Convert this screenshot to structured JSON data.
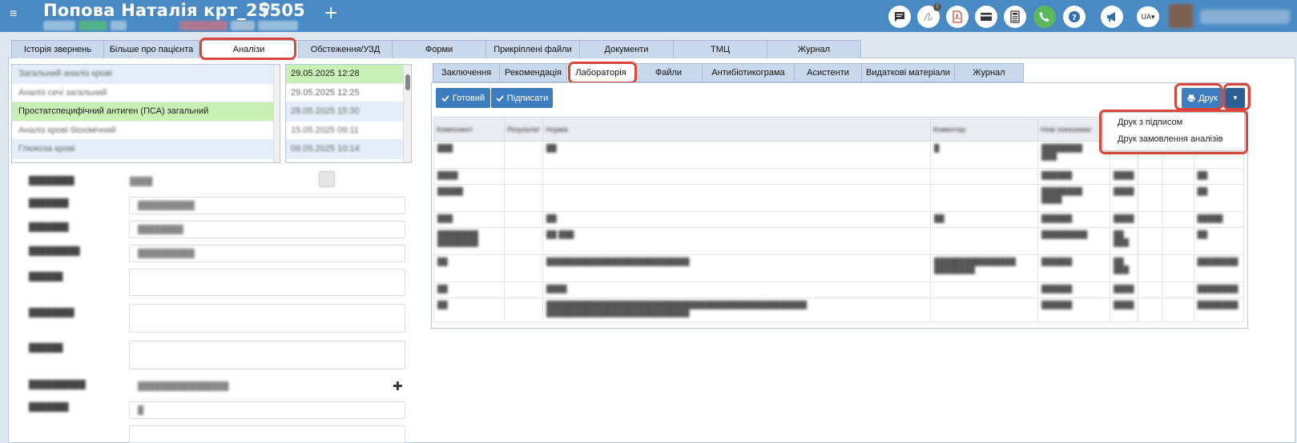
{
  "header": {
    "patient_name": "Попова Наталія крт_25505",
    "gender_symbol": "♀",
    "add_symbol": "+",
    "language": "UA",
    "notification_count": "!"
  },
  "main_tabs": [
    {
      "label": "Історія звернень"
    },
    {
      "label": "Більше про пацієнта"
    },
    {
      "label": "Аналізи"
    },
    {
      "label": "Обстеження/УЗД"
    },
    {
      "label": "Форми"
    },
    {
      "label": "Прикріплені файли"
    },
    {
      "label": "Документи"
    },
    {
      "label": "ТМЦ"
    },
    {
      "label": "Журнал"
    }
  ],
  "analyses_list": [
    {
      "label": "Загальний аналіз крові"
    },
    {
      "label": "Аналіз сечі загальний"
    },
    {
      "label": "Простатспецифічний антиген (ПСА) загальний"
    },
    {
      "label": "Аналіз крові біохімічний"
    },
    {
      "label": "Глюкоза крові"
    }
  ],
  "dates_list": [
    {
      "label": "29.05.2025 12:28"
    },
    {
      "label": "29.05.2025 12:25"
    },
    {
      "label": "28.05.2025 15:30"
    },
    {
      "label": "15.05.2025 09:11"
    },
    {
      "label": "09.05.2025 10:14"
    }
  ],
  "sub_tabs": [
    {
      "label": "Заключення"
    },
    {
      "label": "Рекомендація"
    },
    {
      "label": "Лабораторія"
    },
    {
      "label": "Файли"
    },
    {
      "label": "Антибіотикограма"
    },
    {
      "label": "Асистенти"
    },
    {
      "label": "Видаткові матеріали"
    },
    {
      "label": "Журнал"
    }
  ],
  "toolbar": {
    "ready_label": "Готовий",
    "sign_label": "Підписати",
    "print_label": "Друк"
  },
  "print_menu": {
    "items": [
      "Друк з підписом",
      "Друк замовлення аналізів"
    ]
  },
  "table": {
    "headers": [
      "Компонент",
      "Результат",
      "Норма",
      "Коментар",
      "Нові показники"
    ]
  },
  "colors": {
    "header_bg": "#4a8ac4",
    "button_bg": "#3d7dbf",
    "selected_row": "#c8f0b4",
    "highlight": "#d9463a"
  }
}
